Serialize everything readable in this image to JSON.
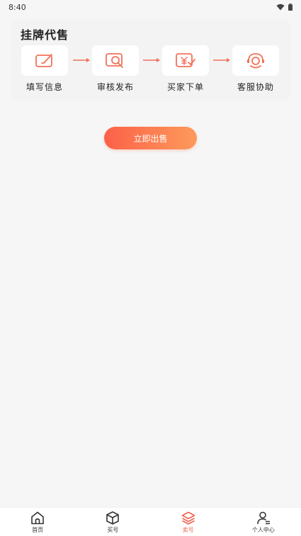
{
  "status": {
    "time": "8:40"
  },
  "process": {
    "title": "挂牌代售",
    "steps": [
      {
        "label": "填写信息",
        "icon": "edit-icon"
      },
      {
        "label": "审核发布",
        "icon": "review-search-icon"
      },
      {
        "label": "买家下单",
        "icon": "yuan-order-icon"
      },
      {
        "label": "客服协助",
        "icon": "customer-service-icon"
      }
    ]
  },
  "action": {
    "sell_label": "立即出售"
  },
  "tabbar": {
    "items": [
      {
        "label": "首页",
        "icon": "home-icon",
        "active": false
      },
      {
        "label": "买号",
        "icon": "box-icon",
        "active": false
      },
      {
        "label": "卖号",
        "icon": "layers-icon",
        "active": true
      },
      {
        "label": "个人中心",
        "icon": "user-icon",
        "active": false
      }
    ]
  },
  "colors": {
    "accent": "#f0634f",
    "gradient_start": "#fb6148",
    "gradient_end": "#fd9a5b",
    "background": "#f6f6f6"
  }
}
